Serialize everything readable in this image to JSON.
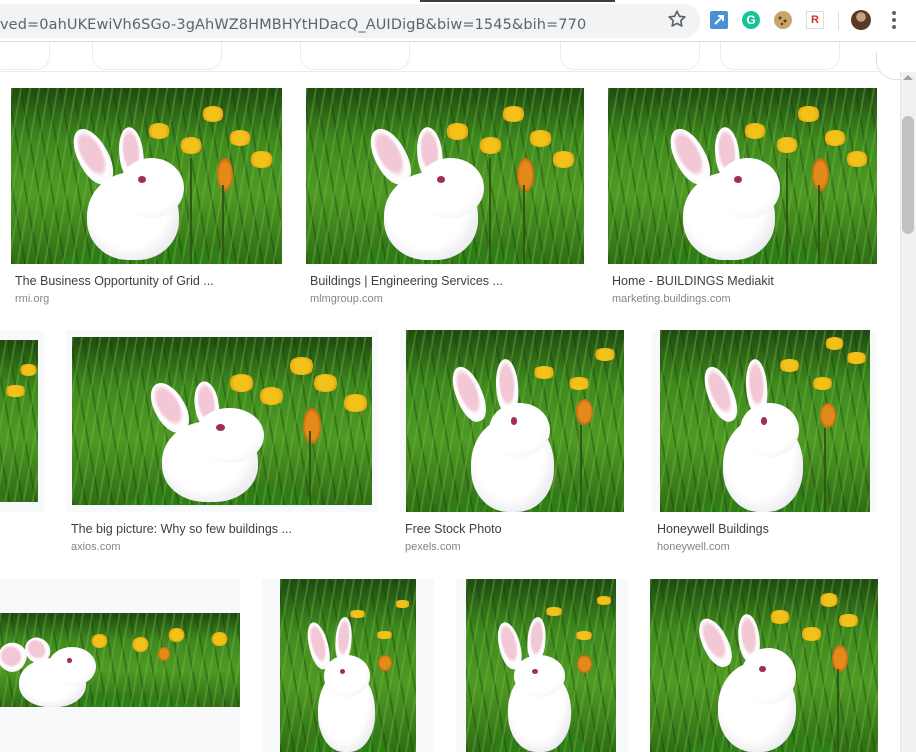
{
  "browser": {
    "url": "ved=0ahUKEwiVh6SGo-3gAhWZ8HMBHYtHDacQ_AUIDigB&biw=1545&bih=770",
    "icons": [
      "star-icon",
      "extension-arrow-icon",
      "grammarly-icon",
      "cookie-icon",
      "r-extension-icon",
      "avatar",
      "kebab-menu-icon"
    ],
    "grammarly_letter": "G",
    "r_extension_letter": "R"
  },
  "results": {
    "row1": [
      {
        "title": "The Business Opportunity of Grid ...",
        "site": "rmi.org"
      },
      {
        "title": "Buildings | Engineering Services ...",
        "site": "mlmgroup.com"
      },
      {
        "title": "Home - BUILDINGS Mediakit",
        "site": "marketing.buildings.com"
      }
    ],
    "row2": [
      {
        "title": "The big picture: Why so few buildings ...",
        "site": "axios.com"
      },
      {
        "title": "Free Stock Photo",
        "site": "pexels.com"
      },
      {
        "title": "Honeywell Buildings",
        "site": "honeywell.com"
      }
    ]
  },
  "colors": {
    "omnibox_bg": "#f1f3f4",
    "title_text": "#3c4043",
    "site_text": "#80868b",
    "grass_green": "#3f8a1f",
    "flower_yellow": "#f3c21a"
  }
}
